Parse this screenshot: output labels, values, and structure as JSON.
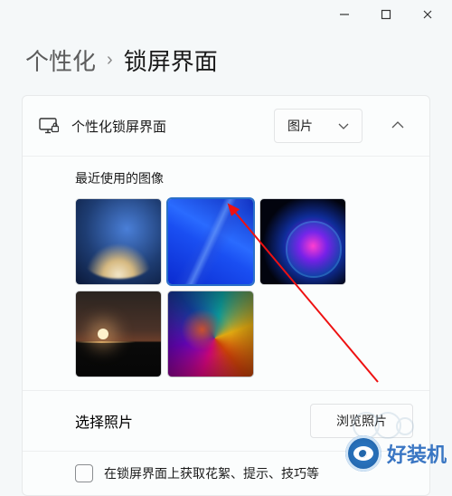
{
  "titlebar": {
    "minimize": "minimize",
    "maximize": "maximize",
    "close": "close"
  },
  "breadcrumb": {
    "parent": "个性化",
    "separator": "›",
    "current": "锁屏界面"
  },
  "lockscreen": {
    "header_icon": "monitor-lock-icon",
    "header_title": "个性化锁屏界面",
    "dropdown_value": "图片",
    "recent_images_label": "最近使用的图像",
    "thumbs": [
      {
        "name": "whale-blue"
      },
      {
        "name": "windows11-bloom-blue",
        "active": true
      },
      {
        "name": "neon-ring"
      },
      {
        "name": "sunset-horizon"
      },
      {
        "name": "color-ribbons"
      }
    ],
    "choose_photo_label": "选择照片",
    "browse_button_label": "浏览照片",
    "tips_checkbox_label": "在锁屏界面上获取花絮、提示、技巧等",
    "tips_checked": false
  },
  "watermark": {
    "text": "好装机"
  }
}
